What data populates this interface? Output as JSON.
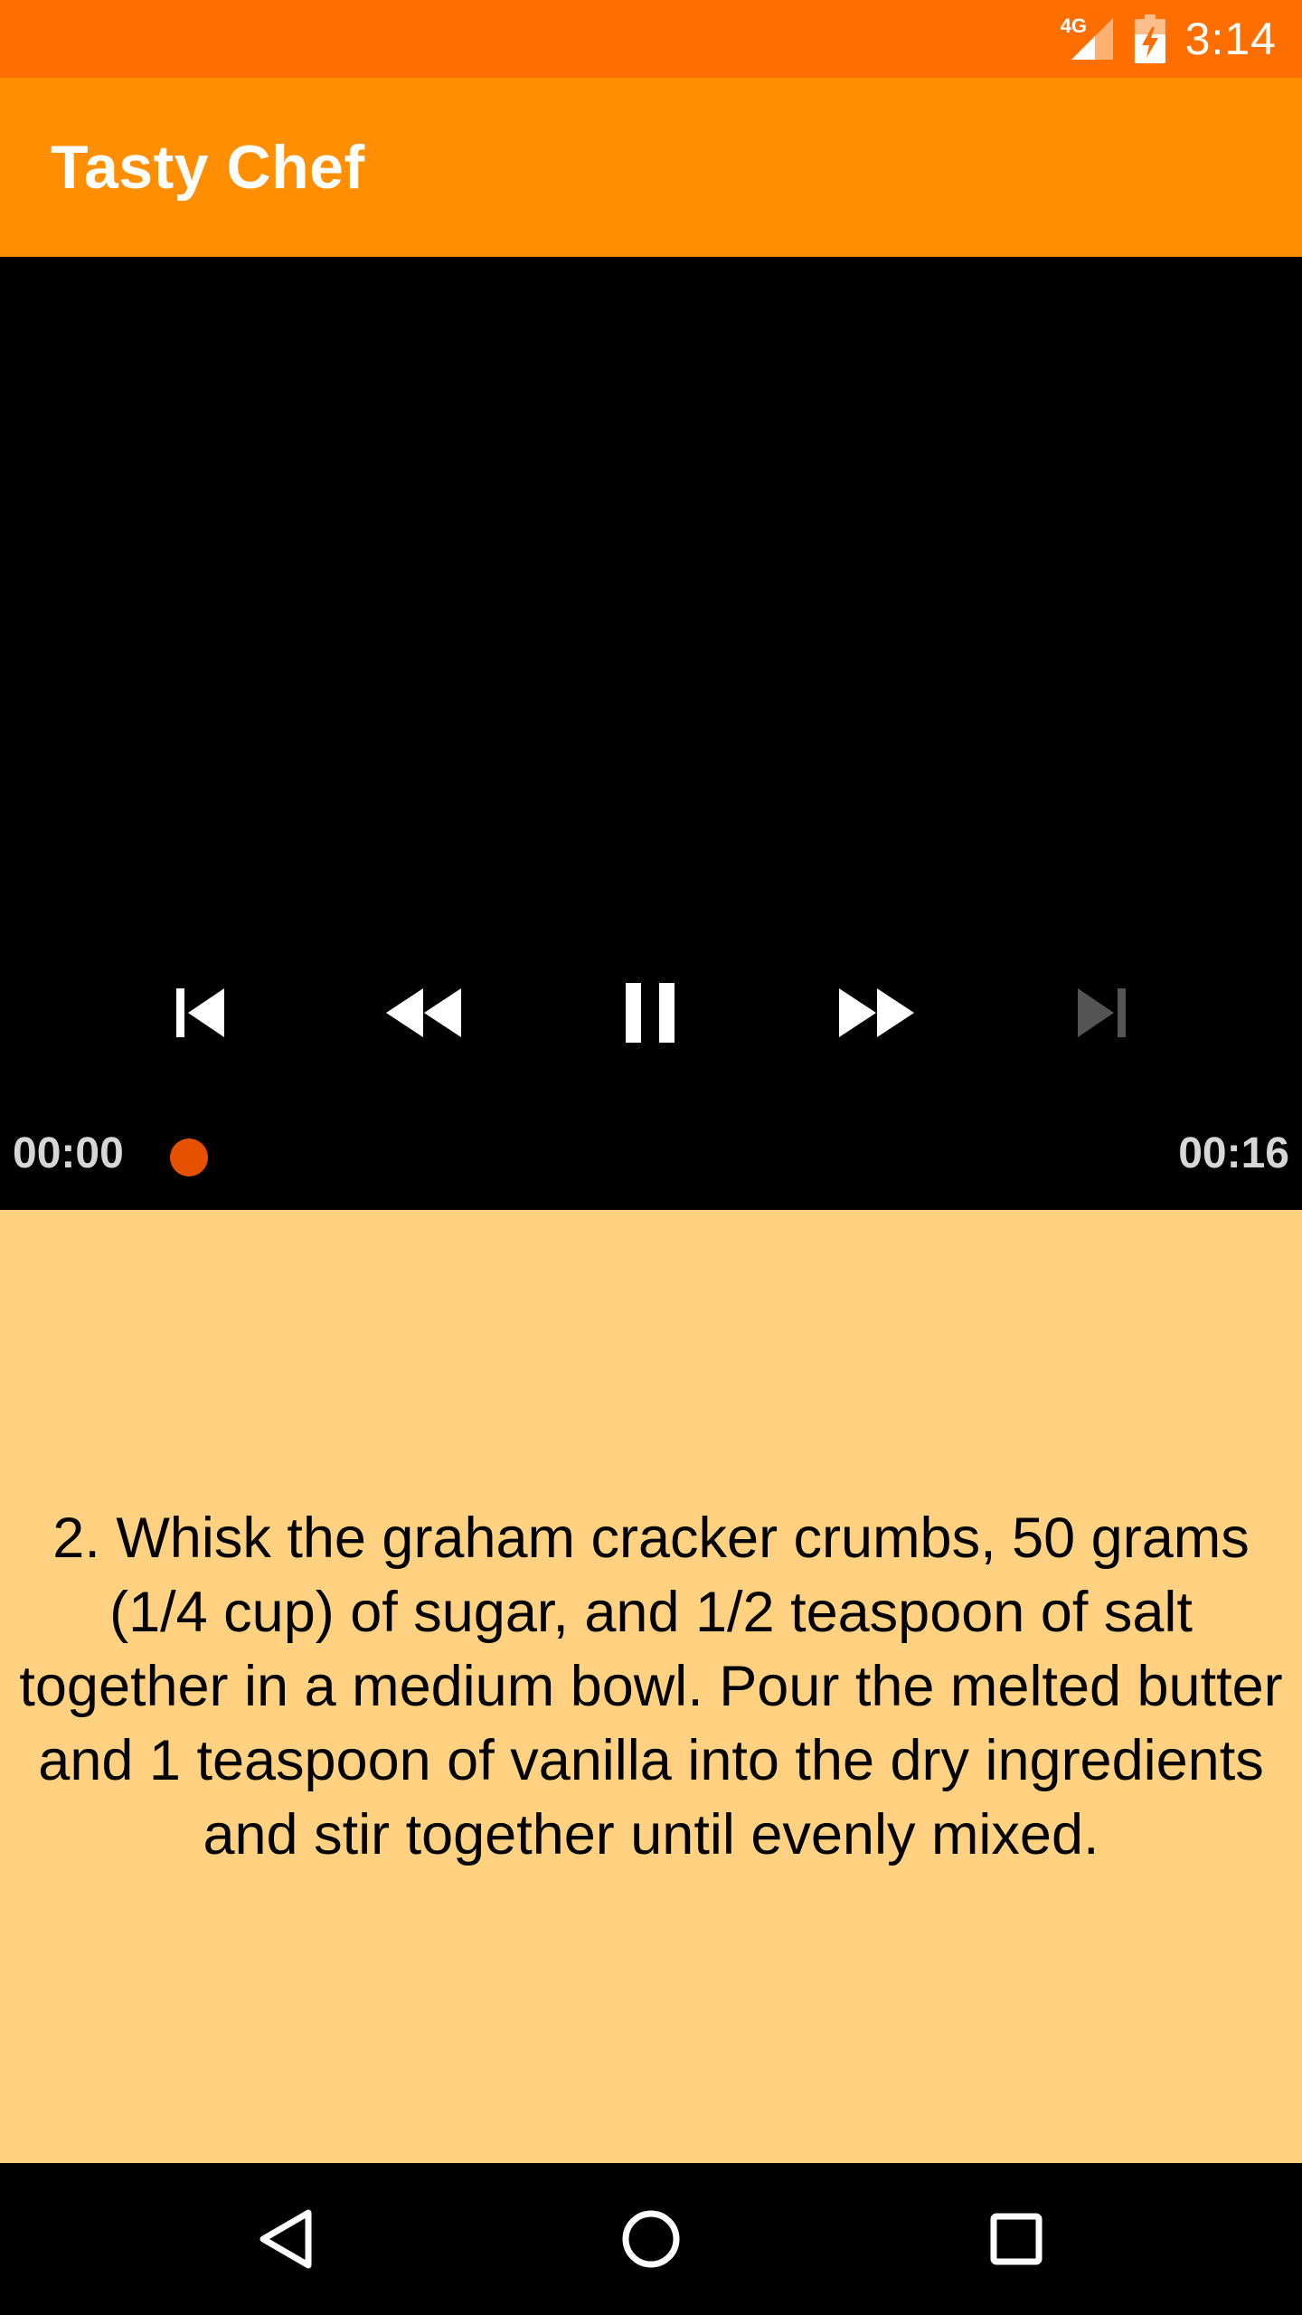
{
  "status_bar": {
    "network": "4G",
    "time": "3:14",
    "icons": [
      "signal-icon",
      "battery-charging-icon"
    ]
  },
  "app_bar": {
    "title": "Tasty Chef"
  },
  "player": {
    "controls": [
      {
        "name": "previous-button",
        "icon": "skip-previous-icon",
        "enabled": true
      },
      {
        "name": "rewind-button",
        "icon": "rewind-icon",
        "enabled": true
      },
      {
        "name": "pause-button",
        "icon": "pause-icon",
        "enabled": true
      },
      {
        "name": "fast-forward-button",
        "icon": "fast-forward-icon",
        "enabled": true
      },
      {
        "name": "next-button",
        "icon": "skip-next-icon",
        "enabled": false
      }
    ],
    "current_time": "00:00",
    "duration": "00:16",
    "progress": 0.0,
    "accent_color": "#E65100"
  },
  "step": {
    "text": "2. Whisk the graham cracker crumbs, 50 grams (1/4 cup) of sugar, and 1/2 teaspoon of salt together in a medium bowl. Pour the melted butter and 1 teaspoon of vanilla into the dry ingredients and stir together until evenly mixed."
  },
  "nav_bar": {
    "buttons": [
      "back-icon",
      "home-icon",
      "recents-icon"
    ]
  },
  "colors": {
    "status_bar": "#FF6F00",
    "app_bar": "#FF8F00",
    "step_background": "#FFD180"
  }
}
